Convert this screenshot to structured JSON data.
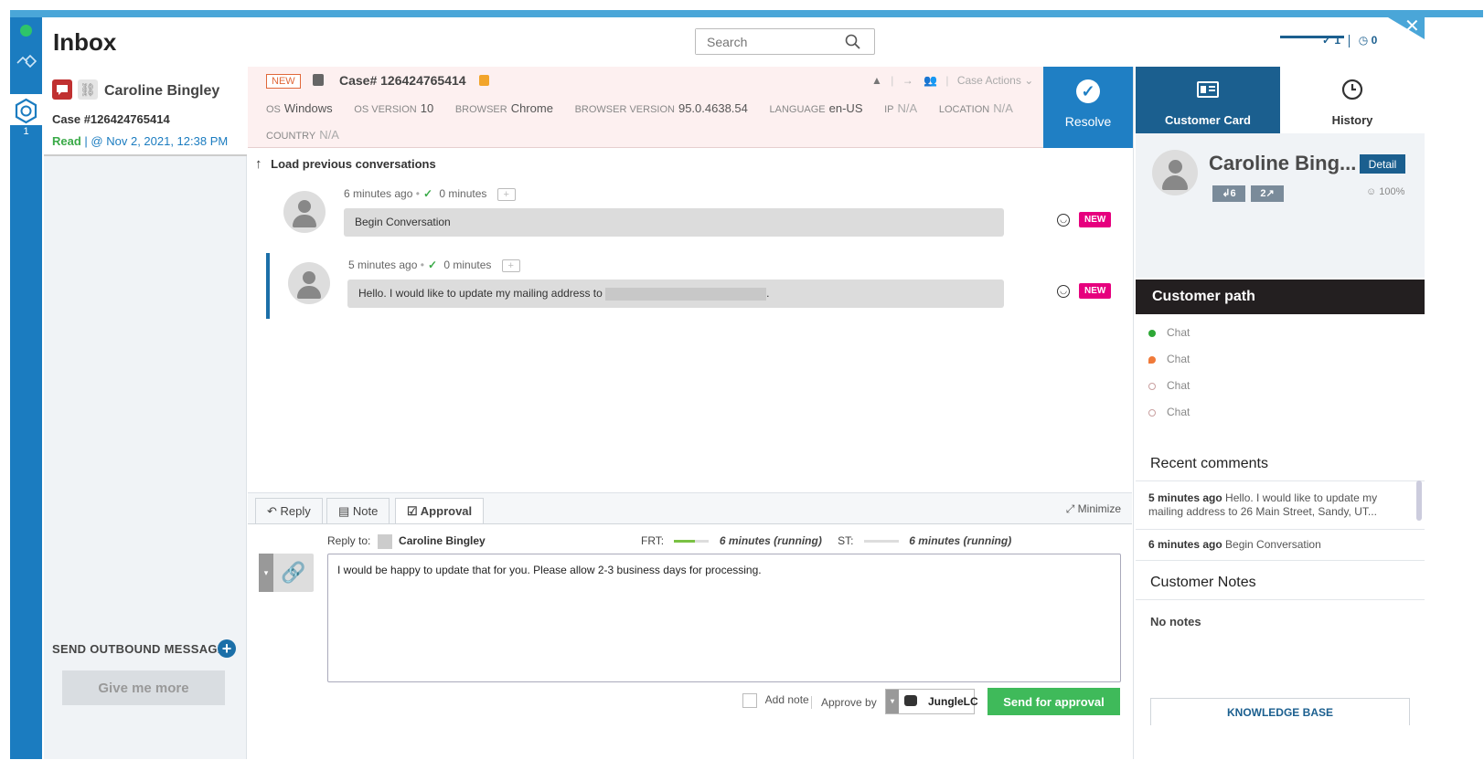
{
  "header": {
    "title": "Inbox",
    "search_placeholder": "Search",
    "resolved_count": "1",
    "pending_count": "0"
  },
  "rail": {
    "badge": "1",
    "status_color": "#2ec46a"
  },
  "case_list": {
    "customer_name": "Caroline Bingley",
    "case_number": "Case #126424765414",
    "status": "Read",
    "timestamp": "@ Nov 2, 2021, 12:38 PM",
    "outbound_label": "SEND OUTBOUND MESSAGE",
    "give_more": "Give me more"
  },
  "case_header": {
    "new_tag": "NEW",
    "case_hash": "Case# 126424765414",
    "case_actions": "Case Actions",
    "os_label": "OS",
    "os_value": "Windows",
    "os_version_label": "OS VERSION",
    "os_version_value": "10",
    "browser_label": "BROWSER",
    "browser_value": "Chrome",
    "browser_version_label": "BROWSER VERSION",
    "browser_version_value": "95.0.4638.54",
    "language_label": "LANGUAGE",
    "language_value": "en-US",
    "ip_label": "IP",
    "ip_value": "N/A",
    "location_label": "LOCATION",
    "location_value": "N/A",
    "country_label": "COUNTRY",
    "country_value": "N/A",
    "resolve_label": "Resolve"
  },
  "conversation": {
    "load_previous": "Load previous conversations",
    "messages": [
      {
        "time": "6 minutes ago",
        "response": "0 minutes",
        "text": "Begin Conversation",
        "badge": "NEW"
      },
      {
        "time": "5 minutes ago",
        "response": "0 minutes",
        "text": "Hello. I would like to update my mailing address to",
        "text_end": ".",
        "badge": "NEW"
      }
    ]
  },
  "composer": {
    "tabs": [
      "Reply",
      "Note",
      "Approval"
    ],
    "minimize": "Minimize",
    "reply_to_label": "Reply to:",
    "reply_to_name": "Caroline Bingley",
    "frt_label": "FRT:",
    "frt_value": "6 minutes (running)",
    "frt_progress": 0.6,
    "st_label": "ST:",
    "st_value": "6 minutes (running)",
    "st_progress": 0.0,
    "body": "I would be happy to update that for you. Please allow 2-3 business days for processing.",
    "add_note": "Add note",
    "approve_by": "Approve by",
    "approver": "JungleLC",
    "send_button": "Send for approval"
  },
  "right_panel": {
    "tabs": [
      "Customer Card",
      "History"
    ],
    "customer_name": "Caroline Bing...",
    "detail_button": "Detail",
    "inbound_count": "6",
    "outbound_count": "2",
    "satisfaction": "100%",
    "path_title": "Customer path",
    "path_items": [
      {
        "label": "Chat",
        "color": "#2ea836"
      },
      {
        "label": "Chat",
        "color": "#f07a3a"
      },
      {
        "label": "Chat",
        "color": "#c9a0a0"
      },
      {
        "label": "Chat",
        "color": "#c9a0a0"
      }
    ],
    "recent_comments_title": "Recent comments",
    "comments": [
      {
        "time": "5 minutes ago",
        "text": "Hello. I would like to update my mailing address to 26 Main Street, Sandy, UT..."
      },
      {
        "time": "6 minutes ago",
        "text": "Begin Conversation"
      }
    ],
    "notes_title": "Customer Notes",
    "no_notes": "No notes",
    "knowledge_base": "KNOWLEDGE BASE"
  }
}
